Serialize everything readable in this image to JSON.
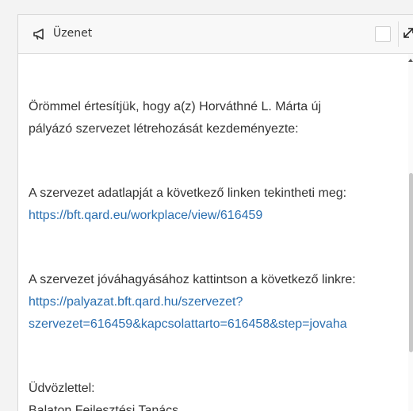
{
  "header": {
    "title": "Üzenet",
    "icon": "megaphone-icon",
    "expand_icon": "expand-icon"
  },
  "message": {
    "intro_line1": "Örömmel értesítjük, hogy a(z) Horváthné L. Márta új",
    "intro_line2": "pályázó szervezet létrehozását kezdeményezte:",
    "profile_text": "A szervezet adatlapját a következő linken tekintheti meg:",
    "profile_link": "https://bft.qard.eu/workplace/view/616459",
    "approve_text": "A szervezet jóváhagyásához kattintson a következő linkre:",
    "approve_link_line1": "https://palyazat.bft.qard.hu/szervezet?",
    "approve_link_line2": "szervezet=616459&kapcsolattarto=616458&step=jovaha",
    "greeting": "Üdvözlettel:",
    "signature": "Balaton Fejlesztési Tanács"
  },
  "colors": {
    "link": "#2a6fb0",
    "text": "#333333",
    "header_bg": "#f8f8f8"
  }
}
